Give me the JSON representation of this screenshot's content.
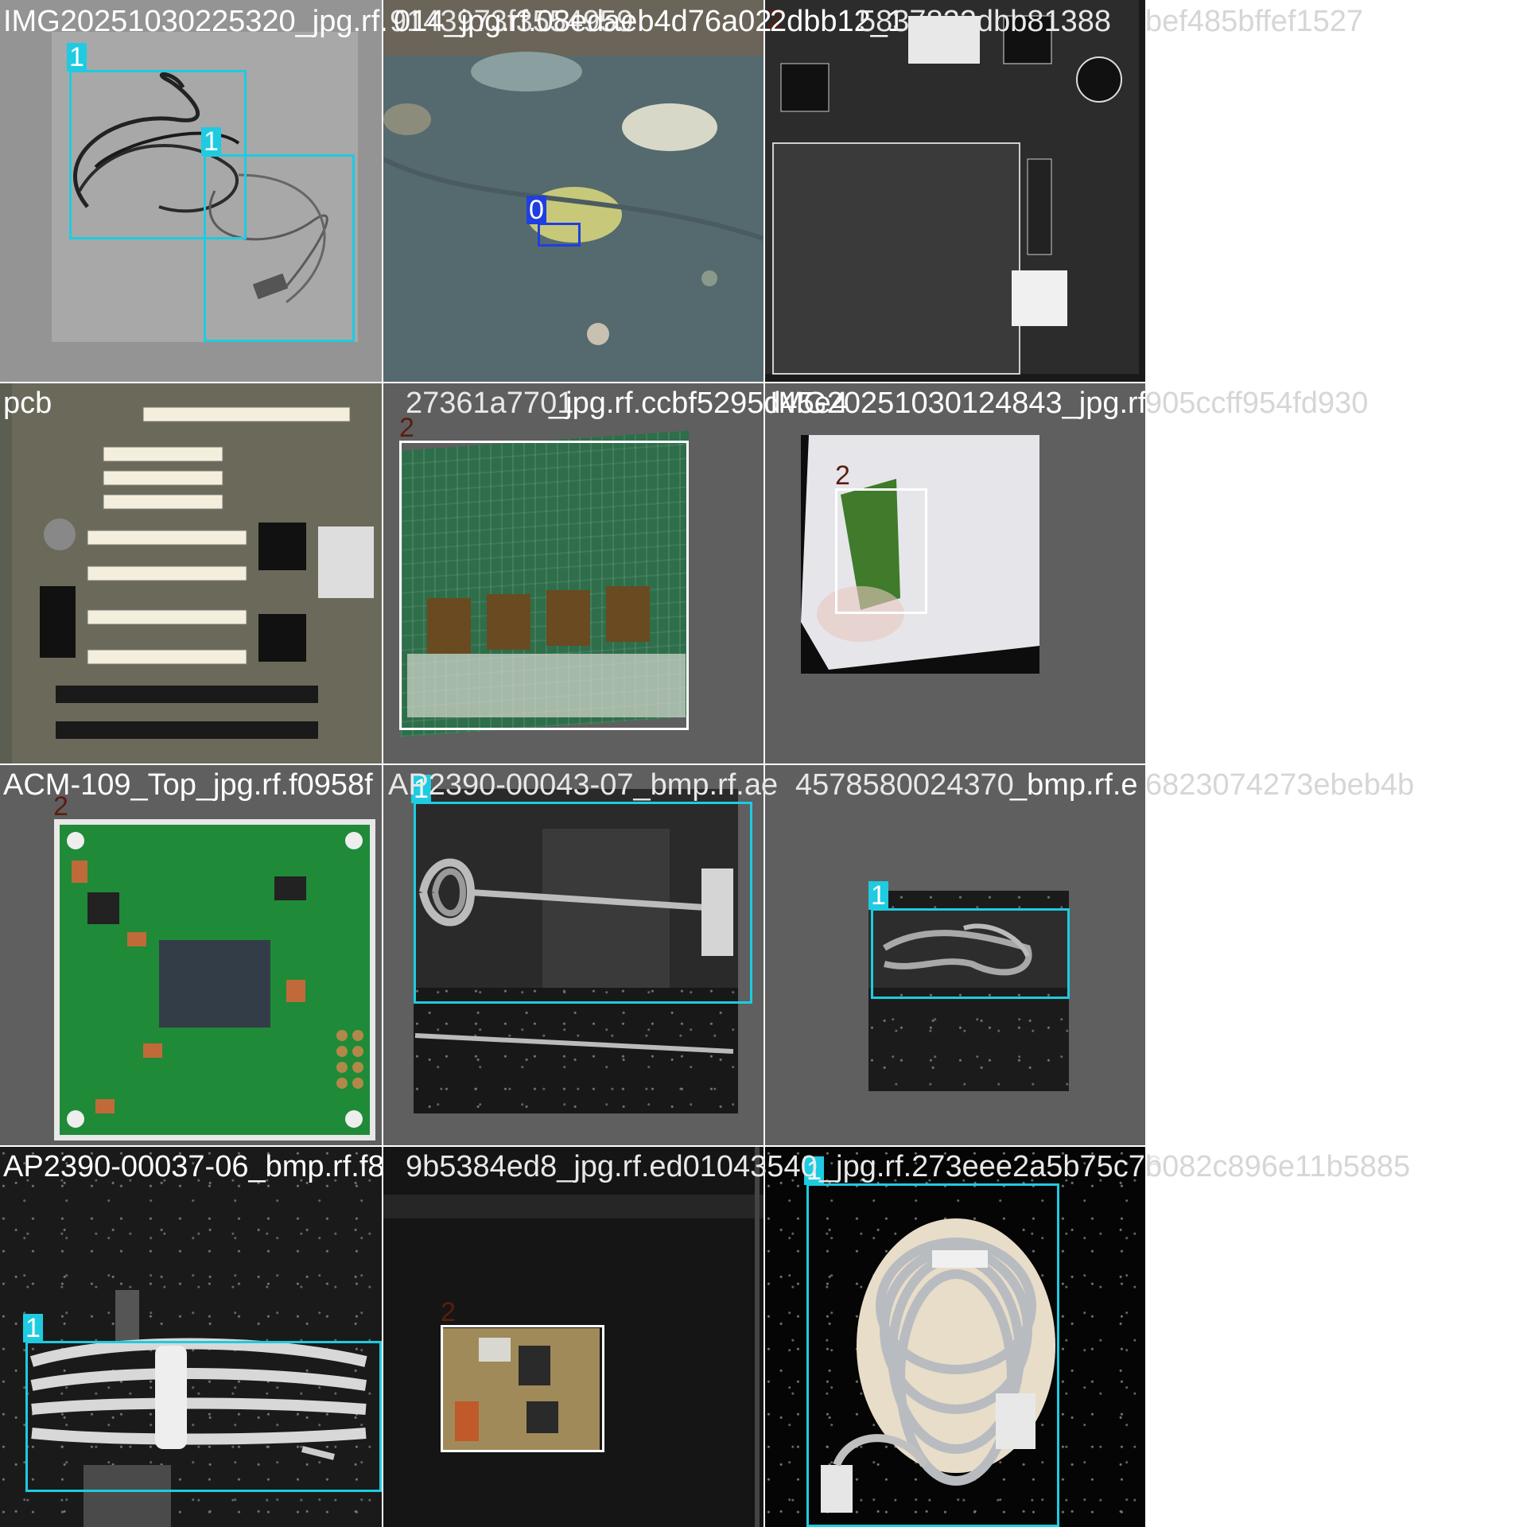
{
  "colors": {
    "class_0": "#1f3fe0",
    "class_1": "#1ecbe1",
    "class_2": "#5a1e10",
    "box_2": "#ffffff"
  },
  "tiles": [
    {
      "title": "IMG20251030225320_jpg.rf.",
      "overlap_titles": [
        "9143973f3554959",
        "014_jpg.rf.08edaeb4d76a02"
      ],
      "labels": [
        "1",
        "1"
      ]
    },
    {
      "title": "",
      "labels": [
        "0"
      ]
    },
    {
      "title": "2dbb12_1",
      "overlap_titles": [
        "5837822dbb81388",
        "bef485bffef1527"
      ],
      "labels": [
        "2"
      ]
    },
    {
      "title": "pcb",
      "overlap_titles": [
        "27361a7701",
        "_jpg.rf.ccbf5295d45e4"
      ],
      "labels": [
        "2",
        "2"
      ]
    },
    {
      "title": "",
      "labels": []
    },
    {
      "title": "IMG20251030124843_jpg.rf.",
      "overlap_titles": [
        "905ccff954fd930"
      ],
      "labels": [
        "2"
      ]
    },
    {
      "title": "ACM-109_Top_jpg.rf.f0958f",
      "overlap_titles": [
        "AP2390-00043-07_bmp.rf.ae",
        "4578580024370",
        "_bmp.rf.e",
        "6823074273ebeb4b"
      ],
      "labels": [
        "2"
      ]
    },
    {
      "title": "",
      "labels": [
        "1"
      ]
    },
    {
      "title": "",
      "labels": [
        "1"
      ]
    },
    {
      "title": "AP2390-00037-06_bmp.rf.f8",
      "overlap_titles": [
        "9b5384ed8_jpg.rf.ed01043540",
        "_jpg.rf.273eee2a5b75c76",
        "b082c896e11b5885"
      ],
      "labels": [
        "1"
      ]
    },
    {
      "title": "",
      "labels": [
        "2"
      ]
    },
    {
      "title": "",
      "labels": [
        "1"
      ]
    }
  ]
}
